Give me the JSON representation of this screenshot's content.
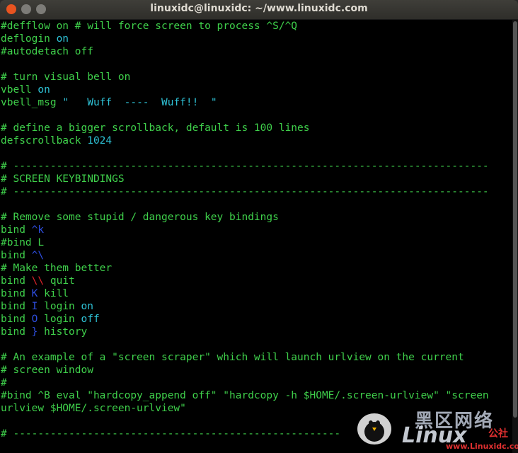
{
  "window": {
    "title": "linuxidc@linuxidc: ~/www.linuxidc.com",
    "buttons": {
      "close": "close",
      "minimize": "minimize",
      "maximize": "maximize"
    }
  },
  "terminal_lines": [
    [
      [
        "c",
        "#defflow on # will force screen to process ^S/^Q"
      ]
    ],
    [
      [
        "k",
        "deflogin "
      ],
      [
        "v",
        "on"
      ]
    ],
    [
      [
        "c",
        "#autodetach off"
      ]
    ],
    [],
    [
      [
        "c",
        "# turn visual bell on"
      ]
    ],
    [
      [
        "k",
        "vbell "
      ],
      [
        "v",
        "on"
      ]
    ],
    [
      [
        "k",
        "vbell_msg "
      ],
      [
        "v",
        "\"   Wuff  ----  Wuff!!  \""
      ]
    ],
    [],
    [
      [
        "c",
        "# define a bigger scrollback, default is 100 lines"
      ]
    ],
    [
      [
        "k",
        "defscrollback "
      ],
      [
        "v",
        "1024"
      ]
    ],
    [],
    [
      [
        "c",
        "# -----------------------------------------------------------------------------"
      ]
    ],
    [
      [
        "c",
        "# SCREEN KEYBINDINGS"
      ]
    ],
    [
      [
        "c",
        "# -----------------------------------------------------------------------------"
      ]
    ],
    [],
    [
      [
        "c",
        "# Remove some stupid / dangerous key bindings"
      ]
    ],
    [
      [
        "k",
        "bind "
      ],
      [
        "b",
        "^k"
      ]
    ],
    [
      [
        "c",
        "#bind L"
      ]
    ],
    [
      [
        "k",
        "bind "
      ],
      [
        "b",
        "^\\"
      ]
    ],
    [
      [
        "c",
        "# Make them better"
      ]
    ],
    [
      [
        "k",
        "bind "
      ],
      [
        "r",
        "\\\\"
      ],
      [
        "k",
        " quit"
      ]
    ],
    [
      [
        "k",
        "bind "
      ],
      [
        "b",
        "K"
      ],
      [
        "k",
        " kill"
      ]
    ],
    [
      [
        "k",
        "bind "
      ],
      [
        "b",
        "I"
      ],
      [
        "k",
        " login "
      ],
      [
        "v",
        "on"
      ]
    ],
    [
      [
        "k",
        "bind "
      ],
      [
        "b",
        "O"
      ],
      [
        "k",
        " login "
      ],
      [
        "v",
        "off"
      ]
    ],
    [
      [
        "k",
        "bind "
      ],
      [
        "b",
        "}"
      ],
      [
        "k",
        " history"
      ]
    ],
    [],
    [
      [
        "c",
        "# An example of a \"screen scraper\" which will launch urlview on the current"
      ]
    ],
    [
      [
        "c",
        "# screen window"
      ]
    ],
    [
      [
        "c",
        "#"
      ]
    ],
    [
      [
        "c",
        "#bind ^B eval \"hardcopy_append off\" \"hardcopy -h $HOME/.screen-urlview\" \"screen"
      ]
    ],
    [
      [
        "c",
        "urlview $HOME/.screen-urlview\""
      ]
    ],
    [],
    [
      [
        "c",
        "# -----------------------------------------------------"
      ]
    ]
  ],
  "watermark": {
    "line1": "黑区网络",
    "line2": "Linux",
    "line3": "公社",
    "line4": "www.Linuxidc.com"
  }
}
